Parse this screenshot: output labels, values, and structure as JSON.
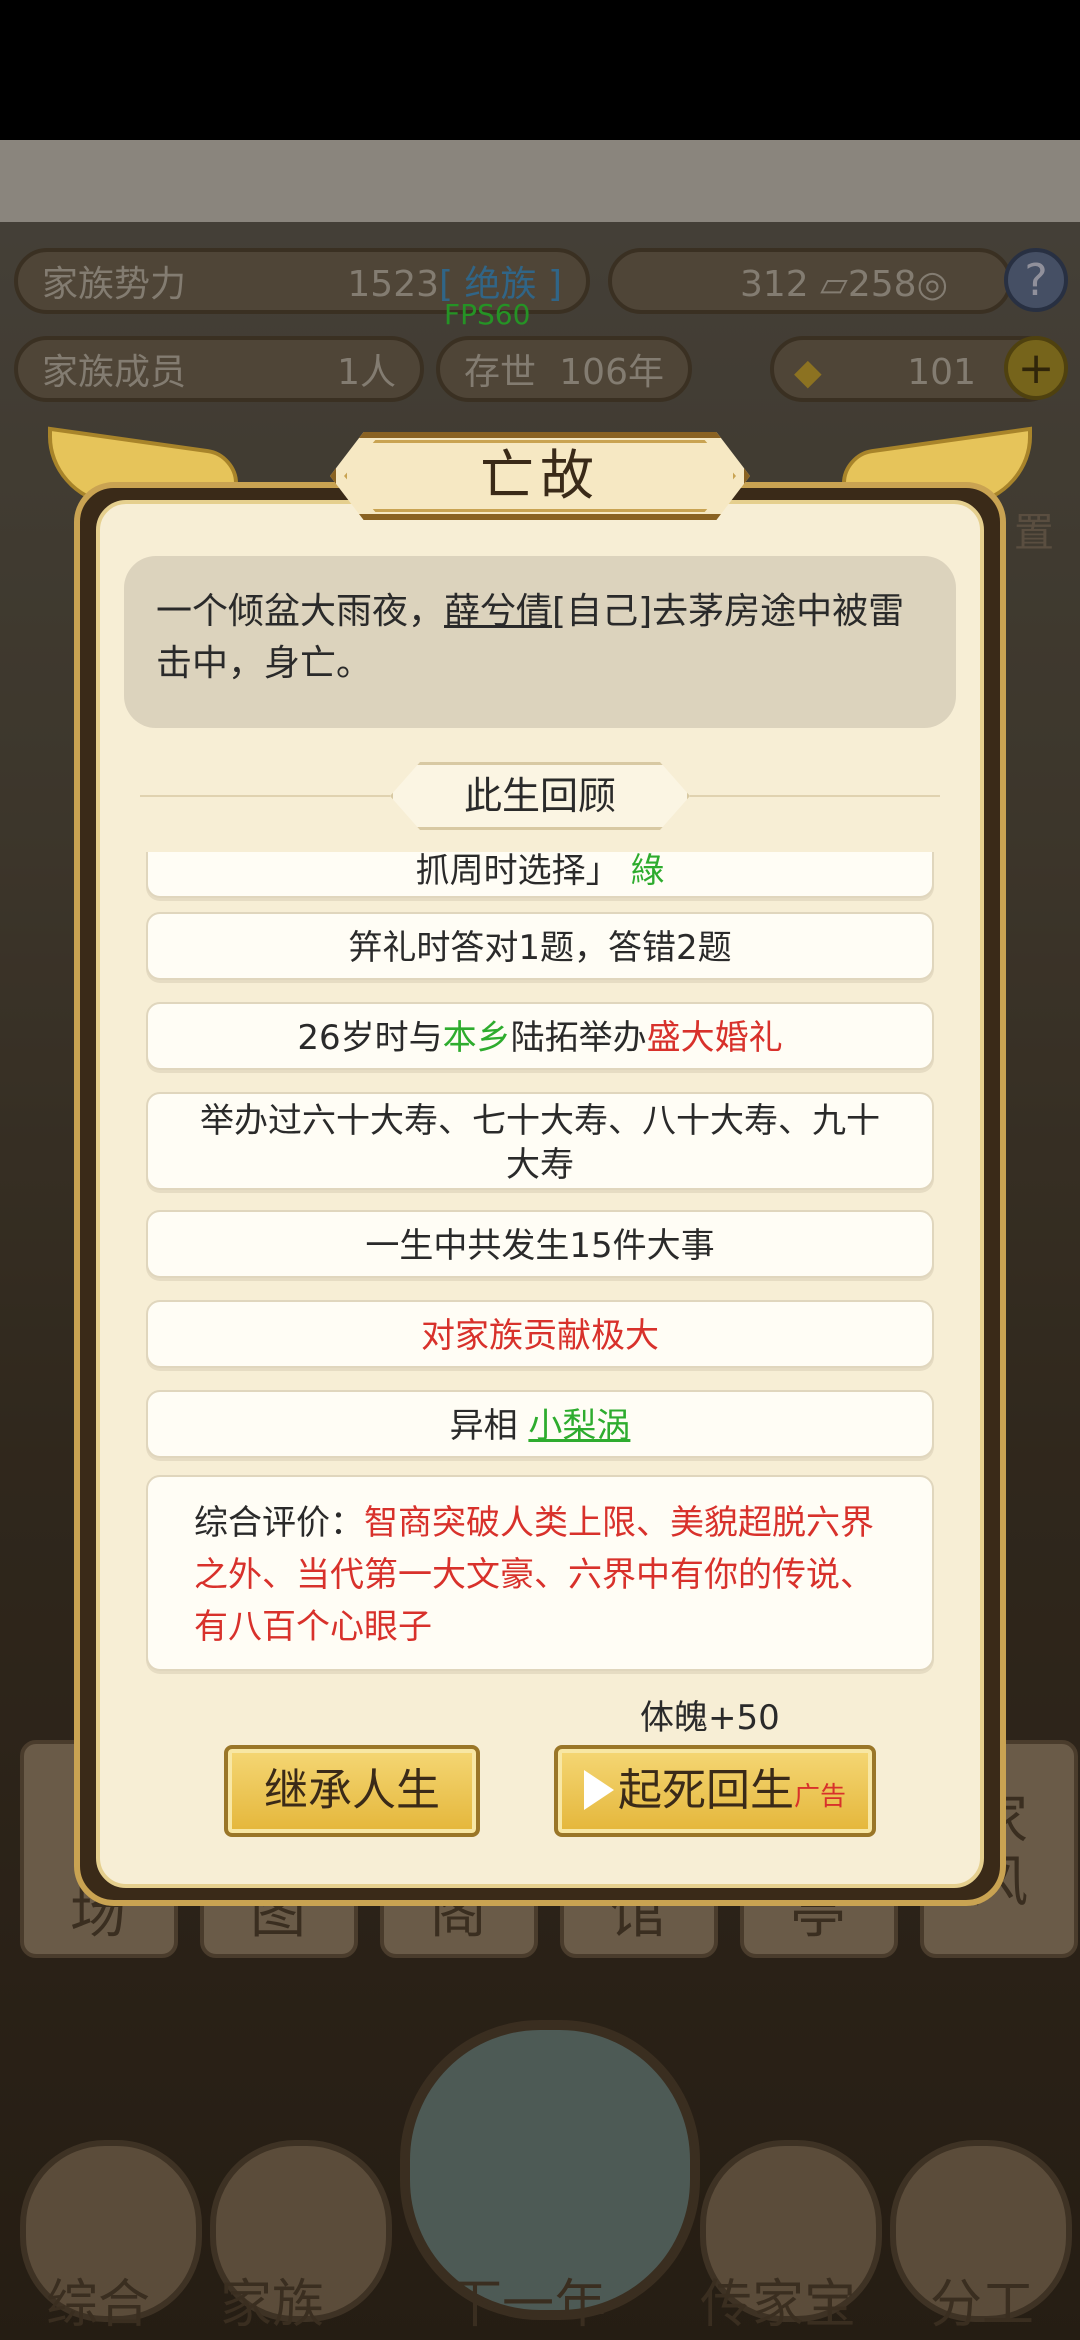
{
  "hud": {
    "power_label": "家族势力",
    "power_value": "1523",
    "power_rank": "[ 绝族 ]",
    "currency_a": "312",
    "currency_b": "258",
    "help": "?",
    "members_label": "家族成员",
    "members_value": "1人",
    "age_label": "存世",
    "age_value": "106年",
    "gold_value": "101",
    "plus": "+",
    "fps": "FPS60"
  },
  "background": {
    "side_text_1": "置",
    "tiles": [
      "场",
      "图",
      "阁",
      "馆",
      "亭",
      "家\n风"
    ],
    "nav": [
      "综合",
      "家族",
      "下一年",
      "传家宝",
      "分工"
    ]
  },
  "dialog": {
    "title": "亡故",
    "message_pre": "一个倾盆大雨夜，",
    "message_name": "薛兮倩",
    "message_post": "[自己]去茅房途中被雷击中，身亡。",
    "review_title": "此生回顾",
    "items": {
      "partial_pre": "抓周时选择",
      "partial_bracket": "」",
      "partial_tag": "綠",
      "ceremony": "笄礼时答对1题，答错2题",
      "wedding_pre": "26岁时与",
      "wedding_place": "本乡",
      "wedding_mid": "陆拓举办",
      "wedding_tag": "盛大婚礼",
      "birthdays": "举办过六十大寿、七十大寿、八十大寿、九十大寿",
      "events": "一生中共发生15件大事",
      "contribution": "对家族贡献极大",
      "omen_label": "异相",
      "omen_value": "小梨涡"
    },
    "evaluation_label": "综合评价：",
    "evaluation_text": "智商突破人类上限、美貌超脱六界之外、当代第一大文豪、六界中有你的传说、有八百个心眼子",
    "reward": "体魄+50",
    "inherit_button": "继承人生",
    "revive_button": "起死回生",
    "ad_tag": "广告"
  }
}
